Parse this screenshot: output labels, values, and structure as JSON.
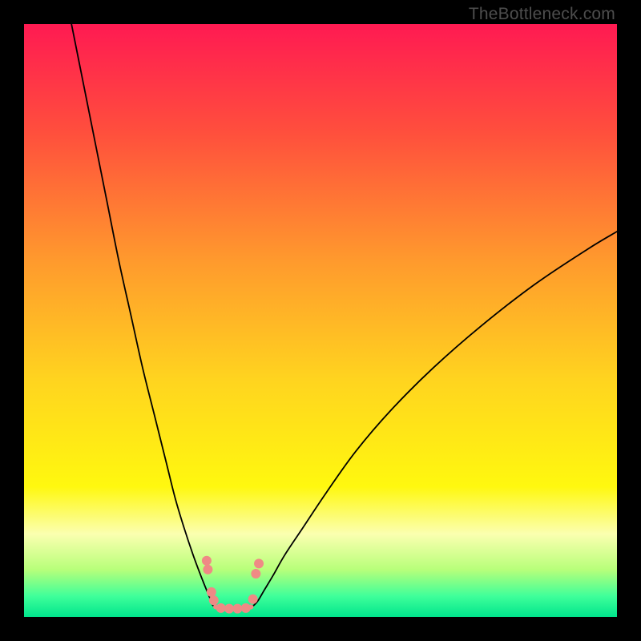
{
  "watermark": "TheBottleneck.com",
  "chart_data": {
    "type": "line",
    "title": "",
    "xlabel": "",
    "ylabel": "",
    "xlim": [
      0,
      100
    ],
    "ylim": [
      0,
      100
    ],
    "grid": false,
    "legend": false,
    "background_gradient_stops": [
      {
        "pos": 0.0,
        "color": "#ff1a52"
      },
      {
        "pos": 0.18,
        "color": "#ff4e3d"
      },
      {
        "pos": 0.4,
        "color": "#ff9a2d"
      },
      {
        "pos": 0.6,
        "color": "#ffd41f"
      },
      {
        "pos": 0.78,
        "color": "#fff80f"
      },
      {
        "pos": 0.86,
        "color": "#fbffb0"
      },
      {
        "pos": 0.92,
        "color": "#b8ff7a"
      },
      {
        "pos": 0.965,
        "color": "#3fff9a"
      },
      {
        "pos": 1.0,
        "color": "#00e58c"
      }
    ],
    "series": [
      {
        "name": "curve-left",
        "stroke": "#000000",
        "stroke_width": 1.8,
        "x": [
          8,
          10,
          12,
          14,
          16,
          18,
          20,
          22,
          24,
          25.5,
          27,
          28.5,
          29.8,
          30.8,
          31.5,
          31.8,
          32.3
        ],
        "y": [
          100,
          90,
          80,
          70,
          60,
          51,
          42,
          34,
          26,
          20,
          15,
          10.5,
          7,
          4.5,
          2.8,
          2.0,
          1.7
        ]
      },
      {
        "name": "curve-right",
        "stroke": "#000000",
        "stroke_width": 1.8,
        "x": [
          38.3,
          38.8,
          39.5,
          40.5,
          42,
          44,
          47,
          51,
          56,
          62,
          69,
          77,
          86,
          95,
          100
        ],
        "y": [
          1.7,
          2.0,
          2.8,
          4.5,
          7,
          10.5,
          15,
          21,
          28,
          35,
          42,
          49,
          56,
          62,
          65
        ]
      },
      {
        "name": "valley-floor",
        "stroke": "#ef8a85",
        "stroke_width": 6,
        "x": [
          32.3,
          33.5,
          35.3,
          37.1,
          38.3
        ],
        "y": [
          1.7,
          1.5,
          1.4,
          1.5,
          1.7
        ]
      }
    ],
    "markers": [
      {
        "name": "dot-left-upper-a",
        "x": 30.8,
        "y": 9.5,
        "r": 6,
        "fill": "#ef8a85"
      },
      {
        "name": "dot-left-upper-b",
        "x": 31.0,
        "y": 8.0,
        "r": 6,
        "fill": "#ef8a85"
      },
      {
        "name": "dot-left-lower-a",
        "x": 31.6,
        "y": 4.2,
        "r": 6,
        "fill": "#ef8a85"
      },
      {
        "name": "dot-left-lower-b",
        "x": 32.0,
        "y": 2.8,
        "r": 6,
        "fill": "#ef8a85"
      },
      {
        "name": "dot-right-upper-a",
        "x": 39.6,
        "y": 9.0,
        "r": 6,
        "fill": "#ef8a85"
      },
      {
        "name": "dot-right-upper-b",
        "x": 39.1,
        "y": 7.3,
        "r": 6,
        "fill": "#ef8a85"
      },
      {
        "name": "dot-right-lower-a",
        "x": 38.6,
        "y": 3.0,
        "r": 6,
        "fill": "#ef8a85"
      },
      {
        "name": "dot-floor-1",
        "x": 33.2,
        "y": 1.5,
        "r": 6,
        "fill": "#ef8a85"
      },
      {
        "name": "dot-floor-2",
        "x": 34.6,
        "y": 1.4,
        "r": 6,
        "fill": "#ef8a85"
      },
      {
        "name": "dot-floor-3",
        "x": 36.0,
        "y": 1.4,
        "r": 6,
        "fill": "#ef8a85"
      },
      {
        "name": "dot-floor-4",
        "x": 37.4,
        "y": 1.5,
        "r": 6,
        "fill": "#ef8a85"
      }
    ]
  }
}
